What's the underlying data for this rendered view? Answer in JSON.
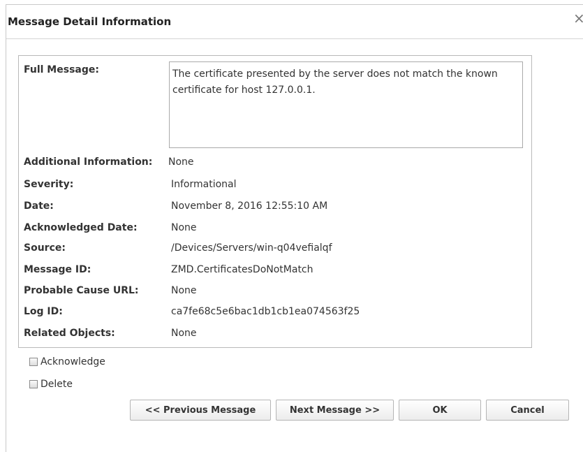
{
  "dialog": {
    "title": "Message Detail Information",
    "close_glyph": "×"
  },
  "details": {
    "full_message_label": "Full Message:",
    "full_message": "The certificate presented by the server does not match the known certificate for host 127.0.0.1.",
    "rows": [
      {
        "label": "Additional Information:",
        "value": "None"
      },
      {
        "label": "Severity:",
        "value": "Informational"
      },
      {
        "label": "Date:",
        "value": "November 8, 2016 12:55:10 AM"
      },
      {
        "label": "Acknowledged Date:",
        "value": "None"
      },
      {
        "label": "Source:",
        "value": "/Devices/Servers/win-q04vefialqf"
      },
      {
        "label": "Message ID:",
        "value": "ZMD.CertificatesDoNotMatch"
      },
      {
        "label": "Probable Cause URL:",
        "value": "None"
      },
      {
        "label": "Log ID:",
        "value": "ca7fe68c5e6bac1db1cb1ea074563f25"
      },
      {
        "label": "Related Objects:",
        "value": "None"
      }
    ]
  },
  "options": {
    "acknowledge_label": "Acknowledge",
    "acknowledge_checked": false,
    "delete_label": "Delete",
    "delete_checked": false
  },
  "buttons": {
    "previous": "<< Previous Message",
    "next": "Next Message >>",
    "ok": "OK",
    "cancel": "Cancel"
  }
}
